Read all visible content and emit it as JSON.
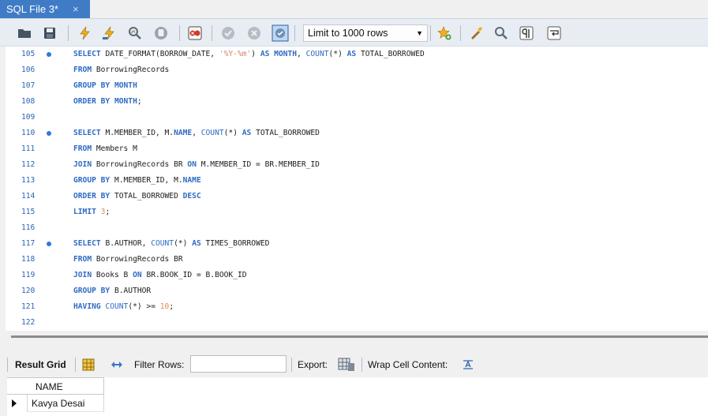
{
  "tab": {
    "title": "SQL File 3*",
    "close": "×"
  },
  "toolbar": {
    "limit_select": "Limit to 1000 rows",
    "icons": [
      "folder-icon",
      "save-icon",
      "execute-icon",
      "execute-current-icon",
      "explain-icon",
      "stop-icon",
      "toggle-error-icon",
      "commit-icon",
      "rollback-icon",
      "autocommit-icon",
      "bookmark-icon",
      "beautify-icon",
      "find-icon",
      "invisible-chars-icon",
      "wrap-icon"
    ]
  },
  "editor": {
    "lines": [
      {
        "n": "105",
        "dot": true,
        "tokens": [
          {
            "t": "kw",
            "v": "SELECT "
          },
          {
            "t": "id",
            "v": "DATE_FORMAT(BORROW_DATE, "
          },
          {
            "t": "str",
            "v": "'%Y-%m'"
          },
          {
            "t": "id",
            "v": ") "
          },
          {
            "t": "kw",
            "v": "AS "
          },
          {
            "t": "kw",
            "v": "MONTH"
          },
          {
            "t": "id",
            "v": ", "
          },
          {
            "t": "fn",
            "v": "COUNT"
          },
          {
            "t": "id",
            "v": "(*) "
          },
          {
            "t": "kw",
            "v": "AS "
          },
          {
            "t": "id",
            "v": "TOTAL_BORROWED"
          }
        ]
      },
      {
        "n": "106",
        "dot": false,
        "tokens": [
          {
            "t": "kw",
            "v": "FROM "
          },
          {
            "t": "id",
            "v": "BorrowingRecords"
          }
        ]
      },
      {
        "n": "107",
        "dot": false,
        "tokens": [
          {
            "t": "kw",
            "v": "GROUP BY "
          },
          {
            "t": "kw",
            "v": "MONTH"
          }
        ]
      },
      {
        "n": "108",
        "dot": false,
        "tokens": [
          {
            "t": "kw",
            "v": "ORDER BY "
          },
          {
            "t": "kw",
            "v": "MONTH"
          },
          {
            "t": "id",
            "v": ";"
          }
        ]
      },
      {
        "n": "109",
        "dot": false,
        "tokens": []
      },
      {
        "n": "110",
        "dot": true,
        "tokens": [
          {
            "t": "kw",
            "v": "SELECT "
          },
          {
            "t": "id",
            "v": "M.MEMBER_ID, M."
          },
          {
            "t": "kw",
            "v": "NAME"
          },
          {
            "t": "id",
            "v": ", "
          },
          {
            "t": "fn",
            "v": "COUNT"
          },
          {
            "t": "id",
            "v": "(*) "
          },
          {
            "t": "kw",
            "v": "AS "
          },
          {
            "t": "id",
            "v": "TOTAL_BORROWED"
          }
        ]
      },
      {
        "n": "111",
        "dot": false,
        "tokens": [
          {
            "t": "kw",
            "v": "FROM "
          },
          {
            "t": "id",
            "v": "Members M"
          }
        ]
      },
      {
        "n": "112",
        "dot": false,
        "tokens": [
          {
            "t": "kw",
            "v": "JOIN "
          },
          {
            "t": "id",
            "v": "BorrowingRecords BR "
          },
          {
            "t": "kw",
            "v": "ON "
          },
          {
            "t": "id",
            "v": "M.MEMBER_ID = BR.MEMBER_ID"
          }
        ]
      },
      {
        "n": "113",
        "dot": false,
        "tokens": [
          {
            "t": "kw",
            "v": "GROUP BY "
          },
          {
            "t": "id",
            "v": "M.MEMBER_ID, M."
          },
          {
            "t": "kw",
            "v": "NAME"
          }
        ]
      },
      {
        "n": "114",
        "dot": false,
        "tokens": [
          {
            "t": "kw",
            "v": "ORDER BY "
          },
          {
            "t": "id",
            "v": "TOTAL_BORROWED "
          },
          {
            "t": "kw",
            "v": "DESC"
          }
        ]
      },
      {
        "n": "115",
        "dot": false,
        "tokens": [
          {
            "t": "kw",
            "v": "LIMIT "
          },
          {
            "t": "num",
            "v": "3"
          },
          {
            "t": "id",
            "v": ";"
          }
        ]
      },
      {
        "n": "116",
        "dot": false,
        "tokens": []
      },
      {
        "n": "117",
        "dot": true,
        "tokens": [
          {
            "t": "kw",
            "v": "SELECT "
          },
          {
            "t": "id",
            "v": "B.AUTHOR, "
          },
          {
            "t": "fn",
            "v": "COUNT"
          },
          {
            "t": "id",
            "v": "(*) "
          },
          {
            "t": "kw",
            "v": "AS "
          },
          {
            "t": "id",
            "v": "TIMES_BORROWED"
          }
        ]
      },
      {
        "n": "118",
        "dot": false,
        "tokens": [
          {
            "t": "kw",
            "v": "FROM "
          },
          {
            "t": "id",
            "v": "BorrowingRecords BR"
          }
        ]
      },
      {
        "n": "119",
        "dot": false,
        "tokens": [
          {
            "t": "kw",
            "v": "JOIN "
          },
          {
            "t": "id",
            "v": "Books B "
          },
          {
            "t": "kw",
            "v": "ON "
          },
          {
            "t": "id",
            "v": "BR.BOOK_ID = B.BOOK_ID"
          }
        ]
      },
      {
        "n": "120",
        "dot": false,
        "tokens": [
          {
            "t": "kw",
            "v": "GROUP BY "
          },
          {
            "t": "id",
            "v": "B.AUTHOR"
          }
        ]
      },
      {
        "n": "121",
        "dot": false,
        "tokens": [
          {
            "t": "kw",
            "v": "HAVING "
          },
          {
            "t": "fn",
            "v": "COUNT"
          },
          {
            "t": "id",
            "v": "(*) >= "
          },
          {
            "t": "num",
            "v": "10"
          },
          {
            "t": "id",
            "v": ";"
          }
        ]
      },
      {
        "n": "122",
        "dot": false,
        "tokens": []
      }
    ]
  },
  "results": {
    "result_grid": "Result Grid",
    "filter_rows": "Filter Rows:",
    "filter_value": "",
    "export": "Export:",
    "wrap": "Wrap Cell Content:",
    "column": "NAME",
    "rows": [
      "Kavya Desai"
    ]
  }
}
